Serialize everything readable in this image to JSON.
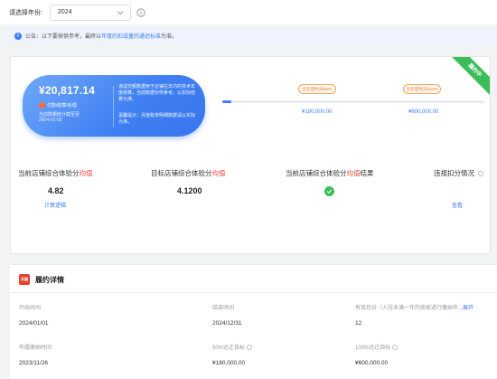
{
  "filter": {
    "label": "请选择年份:",
    "year": "2024"
  },
  "notice": {
    "prefix": "公告：以下要按供参考，最终以",
    "link": "年度的扣或量的通迟标准",
    "suffix": "为准。"
  },
  "badge": "履约中",
  "summary": {
    "amount": "¥20,817.14",
    "status": "付款/结算/处理",
    "line1": "当前数据统计截至至",
    "line2": "2024-01-02",
    "note1": "该成交额数据用于店铺在年内的技术年度核算，当前数据仅供参考，以实际结算为准。",
    "note2": "温馨提示：月度账单明细数据请以实际为准。"
  },
  "progress": {
    "fraction": 0.035,
    "m1": {
      "label": "全年度时间/50%",
      "value": "¥180,000.00"
    },
    "m2": {
      "label": "全年度时间/100%",
      "value": "¥600,000.00"
    }
  },
  "metrics": {
    "current_pre": "当前店铺综合体验分",
    "current_red": "均值",
    "current_value": "4.82",
    "current_link": "计算逻辑",
    "target_pre": "目标店铺综合体验分",
    "target_red": "均值",
    "target_value": "4.1200",
    "result_pre": "当前店铺综合体验分",
    "result_red": "均值",
    "result_post": "结果",
    "violation": "违规扣分情况",
    "violation_link": "查看"
  },
  "details": {
    "title": "履约详情",
    "logo": "天猫",
    "start_label": "开始时间",
    "start_value": "2024/01/01",
    "end_label": "结束时间",
    "end_value": "2024/12/31",
    "months_label": "有效月份（入驻未满一年的商家进行缴纳年...",
    "months_link": "展开",
    "months_value": "12",
    "sign_label": "年履缴纳时间",
    "sign_value": "2023/11/26",
    "target50_label": "50%达迁目标",
    "target50_value": "¥180,000.00",
    "target100_label": "100%达迁目标",
    "target100_value": "¥600,000.00"
  },
  "colors": {
    "accent": "#3e7ff3",
    "success": "#3dbd5a",
    "danger": "#e8402f",
    "warn": "#f07d2a"
  }
}
